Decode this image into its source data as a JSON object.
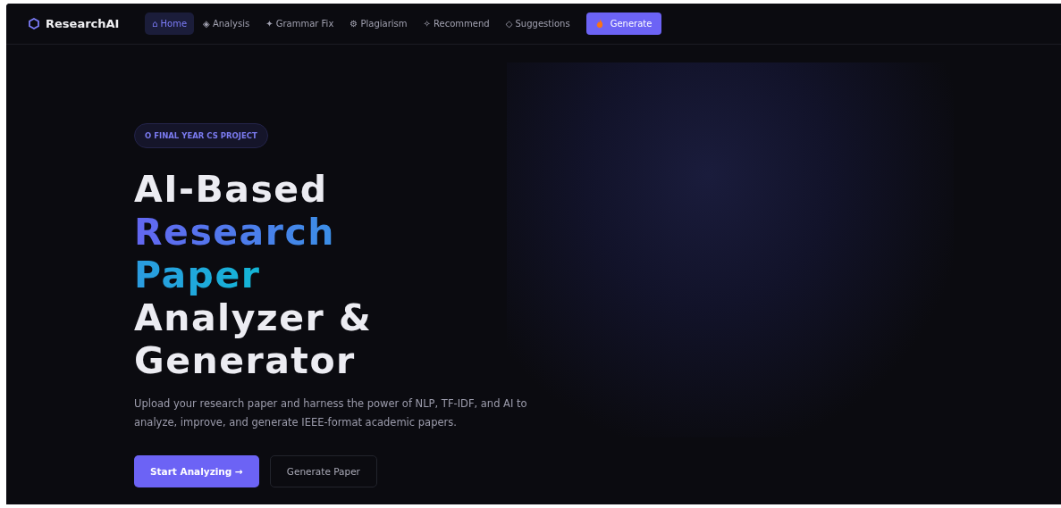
{
  "brand": {
    "name": "ResearchAI"
  },
  "nav": [
    {
      "icon": "⌂",
      "label": "Home",
      "selected": true
    },
    {
      "icon": "◈",
      "label": "Analysis",
      "selected": false
    },
    {
      "icon": "✦",
      "label": "Grammar Fix",
      "selected": false
    },
    {
      "icon": "⚙",
      "label": "Plagiarism",
      "selected": false
    },
    {
      "icon": "✧",
      "label": "Recommend",
      "selected": false
    },
    {
      "icon": "◇",
      "label": "Suggestions",
      "selected": false
    }
  ],
  "nav_button": {
    "label": "Generate"
  },
  "hero": {
    "badge": "O FINAL YEAR CS PROJECT",
    "heading": [
      {
        "text": "AI-Based",
        "kind": "plain"
      },
      {
        "text": "Research",
        "kind": "violet"
      },
      {
        "text": "Paper",
        "kind": "cyan"
      },
      {
        "text": "Analyzer &",
        "kind": "plain"
      },
      {
        "text": "Generator",
        "kind": "plain"
      }
    ],
    "description": "Upload your research paper and harness the power of NLP, TF-IDF, and AI to analyze, improve, and generate IEEE-format academic papers.",
    "buttons": [
      {
        "label": "Start Analyzing →",
        "kind": "primary"
      },
      {
        "label": "Generate Paper",
        "kind": "secondary"
      }
    ]
  }
}
